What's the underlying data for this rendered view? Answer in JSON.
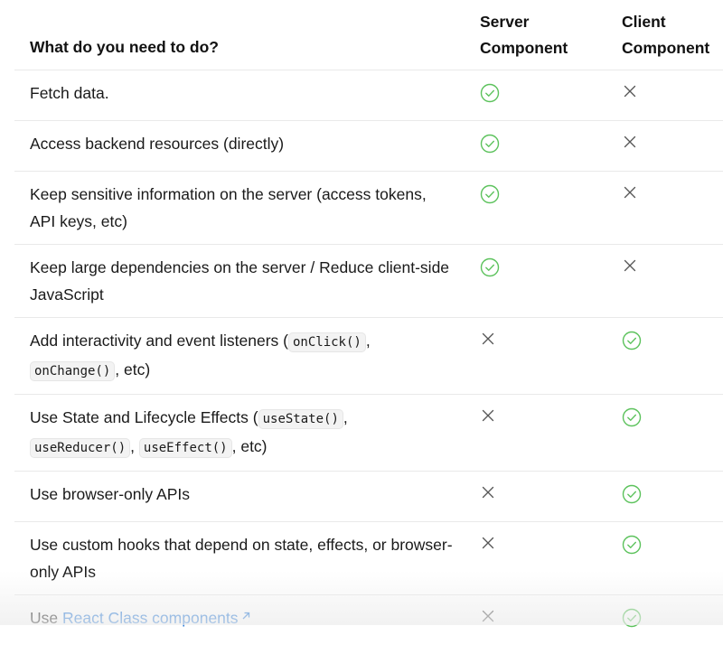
{
  "headers": {
    "question": "What do you need to do?",
    "server_line1": "Server",
    "server_line2": "Component",
    "client_line1": "Client",
    "client_line2": "Component"
  },
  "colors": {
    "check": "#5cc25c",
    "cross": "#555555",
    "link": "#2a7bd8"
  },
  "rows": [
    {
      "text": "Fetch data.",
      "server": "check-icon",
      "client": "x-icon"
    },
    {
      "text": "Access backend resources (directly)",
      "server": "check-icon",
      "client": "x-icon"
    },
    {
      "text": "Keep sensitive information on the server (access tokens, API keys, etc)",
      "server": "check-icon",
      "client": "x-icon"
    },
    {
      "text": "Keep large dependencies on the server / Reduce client-side JavaScript",
      "server": "check-icon",
      "client": "x-icon"
    },
    {
      "parts": [
        "Add interactivity and event listeners (",
        "onClick()",
        ", ",
        "onChange()",
        ", etc)"
      ],
      "server": "x-icon",
      "client": "check-icon"
    },
    {
      "parts": [
        "Use State and Lifecycle Effects (",
        "useState()",
        ", ",
        "useReducer()",
        ", ",
        "useEffect()",
        ", etc)"
      ],
      "server": "x-icon",
      "client": "check-icon"
    },
    {
      "text": "Use browser-only APIs",
      "server": "x-icon",
      "client": "check-icon"
    },
    {
      "text": "Use custom hooks that depend on state, effects, or browser-only APIs",
      "server": "x-icon",
      "client": "check-icon"
    },
    {
      "prefix": "Use ",
      "link": "React Class components",
      "server": "x-icon",
      "client": "check-icon"
    }
  ]
}
